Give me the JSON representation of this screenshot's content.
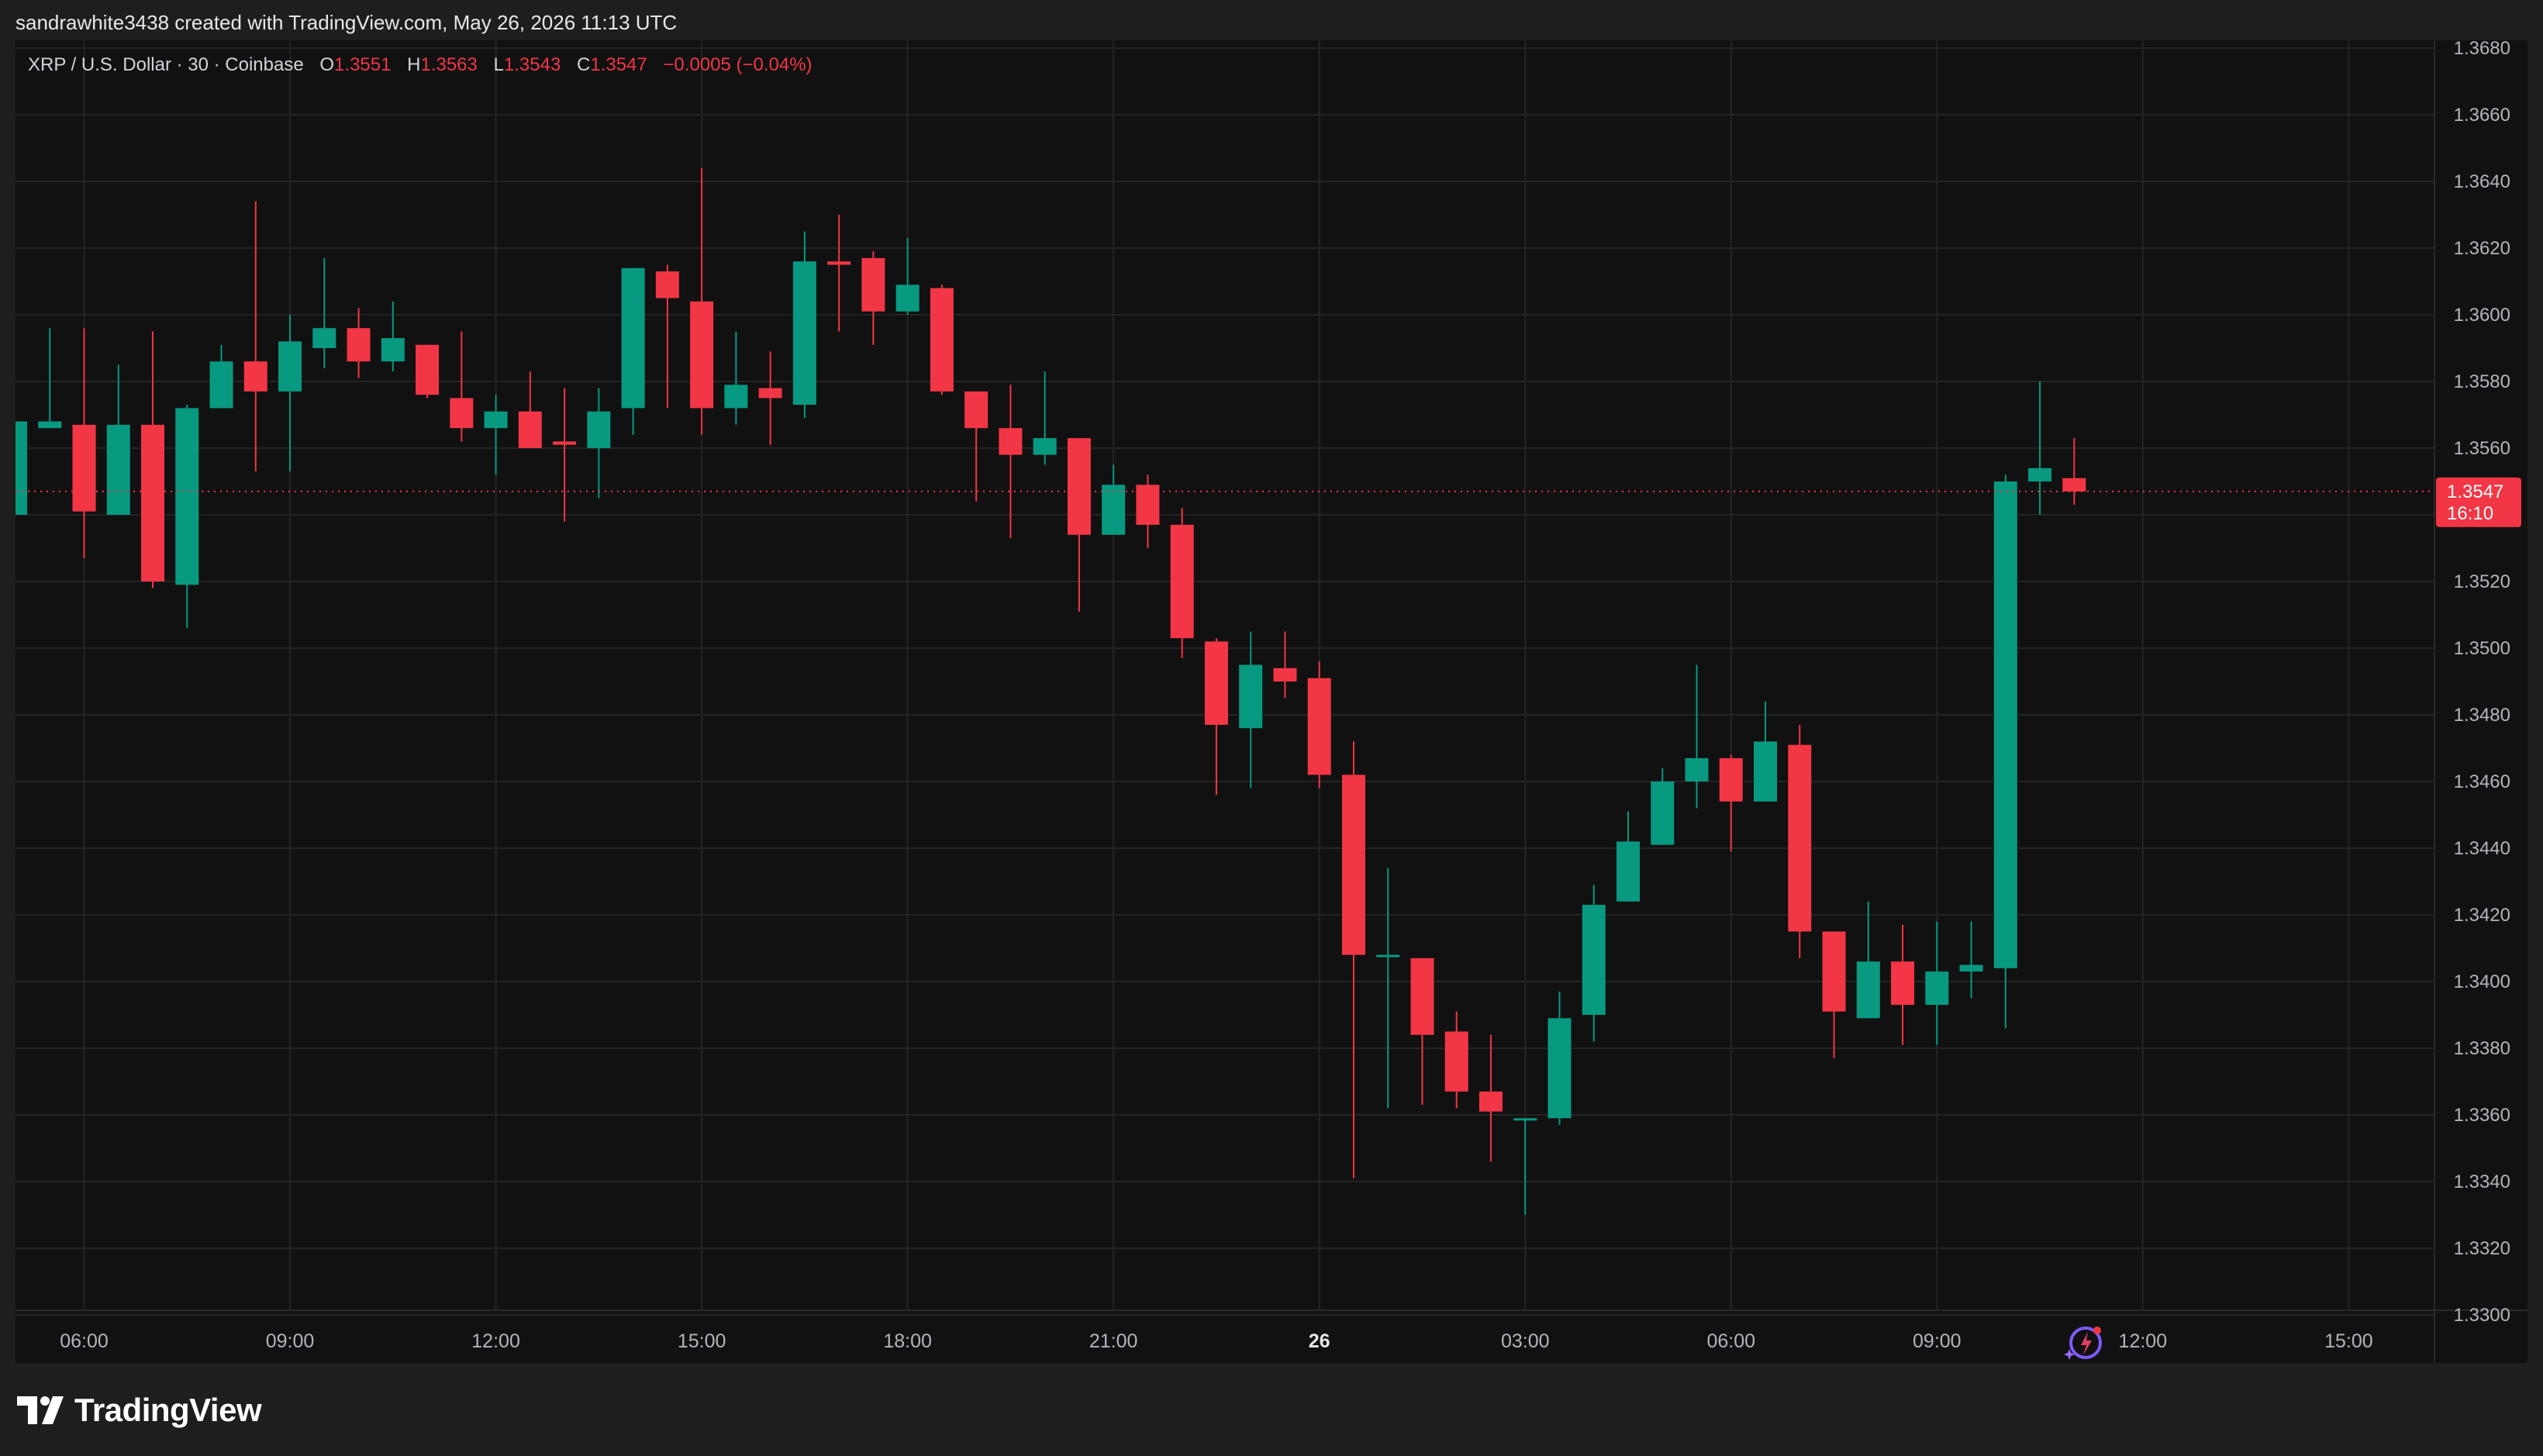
{
  "header": {
    "attribution": "sandrawhite3438 created with TradingView.com, May 26, 2026 11:13 UTC"
  },
  "legend": {
    "symbol": "XRP / U.S. Dollar · 30 · Coinbase",
    "open_label": "O",
    "open": "1.3551",
    "high_label": "H",
    "high": "1.3563",
    "low_label": "L",
    "low": "1.3543",
    "close_label": "C",
    "close": "1.3547",
    "change": "−0.0005 (−0.04%)"
  },
  "price_tag": {
    "price": "1.3547",
    "countdown": "16:10"
  },
  "footer": {
    "brand": "TradingView"
  },
  "colors": {
    "up": "#089981",
    "down": "#f23645",
    "background": "#111111",
    "grid": "#242424",
    "axis_text": "#b2b5be"
  },
  "chart_data": {
    "type": "candlestick",
    "interval": "30",
    "grid": true,
    "y_axis": {
      "ticks": [
        "1.3680",
        "1.3660",
        "1.3640",
        "1.3620",
        "1.3600",
        "1.3580",
        "1.3560",
        "1.3540",
        "1.3520",
        "1.3500",
        "1.3480",
        "1.3460",
        "1.3440",
        "1.3420",
        "1.3400",
        "1.3380",
        "1.3360",
        "1.3340",
        "1.3320",
        "1.3300"
      ],
      "ylim": [
        1.33,
        1.368
      ]
    },
    "x_axis": {
      "tick_labels": [
        "06:00",
        "09:00",
        "12:00",
        "15:00",
        "18:00",
        "21:00",
        "26",
        "03:00",
        "06:00",
        "09:00",
        "12:00",
        "15:00"
      ],
      "tick_times": [
        "2026-05-25 06:00",
        "2026-05-25 09:00",
        "2026-05-25 12:00",
        "2026-05-25 15:00",
        "2026-05-25 18:00",
        "2026-05-25 21:00",
        "2026-05-26 00:00",
        "2026-05-26 03:00",
        "2026-05-26 06:00",
        "2026-05-26 09:00",
        "2026-05-26 12:00",
        "2026-05-26 15:00"
      ],
      "range": [
        "2026-05-25 05:00",
        "2026-05-26 16:15"
      ]
    },
    "last_price": 1.3547,
    "candles": [
      {
        "t": "2026-05-25 05:00",
        "o": 1.354,
        "h": 1.3568,
        "l": 1.354,
        "c": 1.3568
      },
      {
        "t": "2026-05-25 05:30",
        "o": 1.3566,
        "h": 1.3596,
        "l": 1.3566,
        "c": 1.3568
      },
      {
        "t": "2026-05-25 06:00",
        "o": 1.3567,
        "h": 1.3596,
        "l": 1.3527,
        "c": 1.3541
      },
      {
        "t": "2026-05-25 06:30",
        "o": 1.354,
        "h": 1.3585,
        "l": 1.354,
        "c": 1.3567
      },
      {
        "t": "2026-05-25 07:00",
        "o": 1.3567,
        "h": 1.3595,
        "l": 1.3518,
        "c": 1.352
      },
      {
        "t": "2026-05-25 07:30",
        "o": 1.3519,
        "h": 1.3573,
        "l": 1.3506,
        "c": 1.3572
      },
      {
        "t": "2026-05-25 08:00",
        "o": 1.3572,
        "h": 1.3591,
        "l": 1.3572,
        "c": 1.3586
      },
      {
        "t": "2026-05-25 08:30",
        "o": 1.3586,
        "h": 1.3634,
        "l": 1.3553,
        "c": 1.3577
      },
      {
        "t": "2026-05-25 09:00",
        "o": 1.3577,
        "h": 1.36,
        "l": 1.3553,
        "c": 1.3592
      },
      {
        "t": "2026-05-25 09:30",
        "o": 1.359,
        "h": 1.3617,
        "l": 1.3584,
        "c": 1.3596
      },
      {
        "t": "2026-05-25 10:00",
        "o": 1.3596,
        "h": 1.3602,
        "l": 1.3581,
        "c": 1.3586
      },
      {
        "t": "2026-05-25 10:30",
        "o": 1.3586,
        "h": 1.3604,
        "l": 1.3583,
        "c": 1.3593
      },
      {
        "t": "2026-05-25 11:00",
        "o": 1.3591,
        "h": 1.3591,
        "l": 1.3575,
        "c": 1.3576
      },
      {
        "t": "2026-05-25 11:30",
        "o": 1.3575,
        "h": 1.3595,
        "l": 1.3562,
        "c": 1.3566
      },
      {
        "t": "2026-05-25 12:00",
        "o": 1.3566,
        "h": 1.3576,
        "l": 1.3552,
        "c": 1.3571
      },
      {
        "t": "2026-05-25 12:30",
        "o": 1.3571,
        "h": 1.3583,
        "l": 1.356,
        "c": 1.356
      },
      {
        "t": "2026-05-25 13:00",
        "o": 1.3562,
        "h": 1.3578,
        "l": 1.3538,
        "c": 1.3561
      },
      {
        "t": "2026-05-25 13:30",
        "o": 1.356,
        "h": 1.3578,
        "l": 1.3545,
        "c": 1.3571
      },
      {
        "t": "2026-05-25 14:00",
        "o": 1.3572,
        "h": 1.3614,
        "l": 1.3564,
        "c": 1.3614
      },
      {
        "t": "2026-05-25 14:30",
        "o": 1.3613,
        "h": 1.3615,
        "l": 1.3572,
        "c": 1.3605
      },
      {
        "t": "2026-05-25 15:00",
        "o": 1.3604,
        "h": 1.3644,
        "l": 1.3564,
        "c": 1.3572
      },
      {
        "t": "2026-05-25 15:30",
        "o": 1.3572,
        "h": 1.3595,
        "l": 1.3567,
        "c": 1.3579
      },
      {
        "t": "2026-05-25 16:00",
        "o": 1.3578,
        "h": 1.3589,
        "l": 1.3561,
        "c": 1.3575
      },
      {
        "t": "2026-05-25 16:30",
        "o": 1.3573,
        "h": 1.3625,
        "l": 1.3569,
        "c": 1.3616
      },
      {
        "t": "2026-05-25 17:00",
        "o": 1.3616,
        "h": 1.363,
        "l": 1.3595,
        "c": 1.3615
      },
      {
        "t": "2026-05-25 17:30",
        "o": 1.3617,
        "h": 1.3619,
        "l": 1.3591,
        "c": 1.3601
      },
      {
        "t": "2026-05-25 18:00",
        "o": 1.3601,
        "h": 1.3623,
        "l": 1.36,
        "c": 1.3609
      },
      {
        "t": "2026-05-25 18:30",
        "o": 1.3608,
        "h": 1.3609,
        "l": 1.3576,
        "c": 1.3577
      },
      {
        "t": "2026-05-25 19:00",
        "o": 1.3577,
        "h": 1.3577,
        "l": 1.3544,
        "c": 1.3566
      },
      {
        "t": "2026-05-25 19:30",
        "o": 1.3566,
        "h": 1.3579,
        "l": 1.3533,
        "c": 1.3558
      },
      {
        "t": "2026-05-25 20:00",
        "o": 1.3558,
        "h": 1.3583,
        "l": 1.3555,
        "c": 1.3563
      },
      {
        "t": "2026-05-25 20:30",
        "o": 1.3563,
        "h": 1.3563,
        "l": 1.3511,
        "c": 1.3534
      },
      {
        "t": "2026-05-25 21:00",
        "o": 1.3534,
        "h": 1.3555,
        "l": 1.3534,
        "c": 1.3549
      },
      {
        "t": "2026-05-25 21:30",
        "o": 1.3549,
        "h": 1.3552,
        "l": 1.353,
        "c": 1.3537
      },
      {
        "t": "2026-05-25 22:00",
        "o": 1.3537,
        "h": 1.3542,
        "l": 1.3497,
        "c": 1.3503
      },
      {
        "t": "2026-05-25 22:30",
        "o": 1.3502,
        "h": 1.3503,
        "l": 1.3456,
        "c": 1.3477
      },
      {
        "t": "2026-05-25 23:00",
        "o": 1.3476,
        "h": 1.3505,
        "l": 1.3458,
        "c": 1.3495
      },
      {
        "t": "2026-05-25 23:30",
        "o": 1.3494,
        "h": 1.3505,
        "l": 1.3485,
        "c": 1.349
      },
      {
        "t": "2026-05-26 00:00",
        "o": 1.3491,
        "h": 1.3496,
        "l": 1.3458,
        "c": 1.3462
      },
      {
        "t": "2026-05-26 00:30",
        "o": 1.3462,
        "h": 1.3472,
        "l": 1.3341,
        "c": 1.3408
      },
      {
        "t": "2026-05-26 01:00",
        "o": 1.3408,
        "h": 1.3434,
        "l": 1.3362,
        "c": 1.3408
      },
      {
        "t": "2026-05-26 01:30",
        "o": 1.3407,
        "h": 1.3407,
        "l": 1.3363,
        "c": 1.3384
      },
      {
        "t": "2026-05-26 02:00",
        "o": 1.3385,
        "h": 1.3391,
        "l": 1.3362,
        "c": 1.3367
      },
      {
        "t": "2026-05-26 02:30",
        "o": 1.3367,
        "h": 1.3384,
        "l": 1.3346,
        "c": 1.3361
      },
      {
        "t": "2026-05-26 03:00",
        "o": 1.3359,
        "h": 1.3359,
        "l": 1.333,
        "c": 1.3359
      },
      {
        "t": "2026-05-26 03:30",
        "o": 1.3359,
        "h": 1.3397,
        "l": 1.3357,
        "c": 1.3389
      },
      {
        "t": "2026-05-26 04:00",
        "o": 1.339,
        "h": 1.3429,
        "l": 1.3382,
        "c": 1.3423
      },
      {
        "t": "2026-05-26 04:30",
        "o": 1.3424,
        "h": 1.3451,
        "l": 1.3424,
        "c": 1.3442
      },
      {
        "t": "2026-05-26 05:00",
        "o": 1.3441,
        "h": 1.3464,
        "l": 1.3441,
        "c": 1.346
      },
      {
        "t": "2026-05-26 05:30",
        "o": 1.346,
        "h": 1.3495,
        "l": 1.3452,
        "c": 1.3467
      },
      {
        "t": "2026-05-26 06:00",
        "o": 1.3467,
        "h": 1.3468,
        "l": 1.3439,
        "c": 1.3454
      },
      {
        "t": "2026-05-26 06:30",
        "o": 1.3454,
        "h": 1.3484,
        "l": 1.3454,
        "c": 1.3472
      },
      {
        "t": "2026-05-26 07:00",
        "o": 1.3471,
        "h": 1.3477,
        "l": 1.3407,
        "c": 1.3415
      },
      {
        "t": "2026-05-26 07:30",
        "o": 1.3415,
        "h": 1.3415,
        "l": 1.3377,
        "c": 1.3391
      },
      {
        "t": "2026-05-26 08:00",
        "o": 1.3389,
        "h": 1.3424,
        "l": 1.3389,
        "c": 1.3406
      },
      {
        "t": "2026-05-26 08:30",
        "o": 1.3406,
        "h": 1.3417,
        "l": 1.3381,
        "c": 1.3393
      },
      {
        "t": "2026-05-26 09:00",
        "o": 1.3393,
        "h": 1.3418,
        "l": 1.3381,
        "c": 1.3403
      },
      {
        "t": "2026-05-26 09:30",
        "o": 1.3403,
        "h": 1.3418,
        "l": 1.3395,
        "c": 1.3405
      },
      {
        "t": "2026-05-26 10:00",
        "o": 1.3404,
        "h": 1.3552,
        "l": 1.3386,
        "c": 1.355
      },
      {
        "t": "2026-05-26 10:30",
        "o": 1.355,
        "h": 1.358,
        "l": 1.354,
        "c": 1.3554
      },
      {
        "t": "2026-05-26 11:00",
        "o": 1.3551,
        "h": 1.3563,
        "l": 1.3543,
        "c": 1.3547
      }
    ]
  }
}
